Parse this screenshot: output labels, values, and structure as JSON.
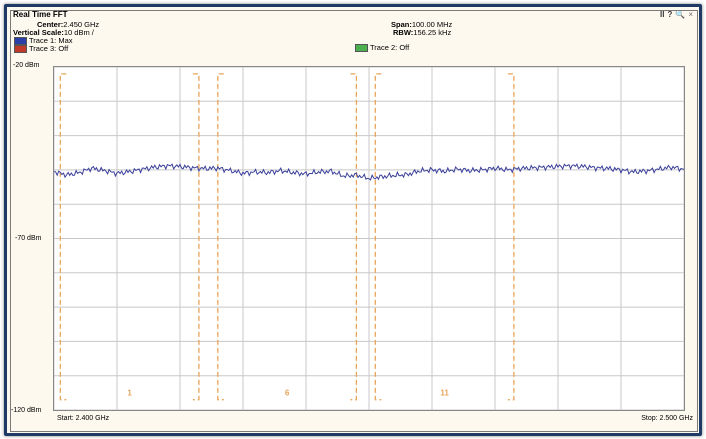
{
  "window": {
    "title": "Real Time FFT",
    "controls": [
      "II",
      "?",
      "🔍",
      "×"
    ]
  },
  "info": {
    "center_label": "Center:",
    "center_value": "2.450 GHz",
    "vscale_label": "Vertical Scale:",
    "vscale_value": "10 dBm /",
    "span_label": "Span:",
    "span_value": "100.00 MHz",
    "rbw_label": "RBW:",
    "rbw_value": "156.25 kHz"
  },
  "legend": [
    {
      "label": "Trace 1: Max",
      "color": "#2b3fa8"
    },
    {
      "label": "Trace 3: Off",
      "color": "#c0392b"
    },
    {
      "label": "Trace 2: Off",
      "color": "#4caf50"
    }
  ],
  "colors": {
    "trace": "#3a3f9a",
    "channel": "#e8a45a",
    "grid": "#c8c8c8",
    "frame": "#1f3a66"
  },
  "chart_data": {
    "type": "line",
    "x_start_label": "Start: 2.400 GHz",
    "x_stop_label": "Stop: 2.500 GHz",
    "xlim": [
      2.4,
      2.5
    ],
    "ylim": [
      -120,
      -20
    ],
    "ytick_labels": [
      {
        "value": -20,
        "label": "-20 dBm"
      },
      {
        "value": -70,
        "label": "-70 dBm"
      },
      {
        "value": -120,
        "label": "-120 dBm"
      }
    ],
    "y_gridlines": [
      -20,
      -30,
      -40,
      -50,
      -60,
      -70,
      -80,
      -90,
      -100,
      -110,
      -120
    ],
    "x_gridlines": 10,
    "grid": true,
    "channels": [
      {
        "label": "1",
        "start": 2.401,
        "stop": 2.423
      },
      {
        "label": "6",
        "start": 2.426,
        "stop": 2.448
      },
      {
        "label": "11",
        "start": 2.451,
        "stop": 2.473
      }
    ],
    "channel_top_dbm": -22,
    "channel_bottom_dbm": -117,
    "series": [
      {
        "x": [
          2.4,
          2.402,
          2.404,
          2.406,
          2.408,
          2.41,
          2.412,
          2.414,
          2.416,
          2.418,
          2.42,
          2.422,
          2.424,
          2.426,
          2.428,
          2.43,
          2.432,
          2.434,
          2.436,
          2.438,
          2.44,
          2.442,
          2.444,
          2.446,
          2.448,
          2.45,
          2.452,
          2.454,
          2.456,
          2.458,
          2.46,
          2.462,
          2.464,
          2.466,
          2.468,
          2.47,
          2.472,
          2.474,
          2.476,
          2.478,
          2.48,
          2.482,
          2.484,
          2.486,
          2.488,
          2.49,
          2.492,
          2.494,
          2.496,
          2.498,
          2.5
        ],
        "y": [
          -50.5,
          -51.5,
          -50.8,
          -49.5,
          -50.2,
          -51.0,
          -50.5,
          -49.8,
          -49.2,
          -48.8,
          -49.0,
          -49.4,
          -49.6,
          -49.5,
          -50.2,
          -51.0,
          -50.6,
          -50.8,
          -50.2,
          -50.8,
          -51.2,
          -50.6,
          -50.4,
          -51.8,
          -51.5,
          -52.5,
          -52.0,
          -51.6,
          -51.4,
          -50.3,
          -50.0,
          -50.4,
          -49.8,
          -50.2,
          -50.0,
          -49.5,
          -50.0,
          -49.6,
          -49.4,
          -49.2,
          -49.0,
          -48.8,
          -49.0,
          -49.4,
          -49.6,
          -50.0,
          -50.6,
          -50.3,
          -49.8,
          -49.2,
          -49.8
        ]
      }
    ]
  }
}
